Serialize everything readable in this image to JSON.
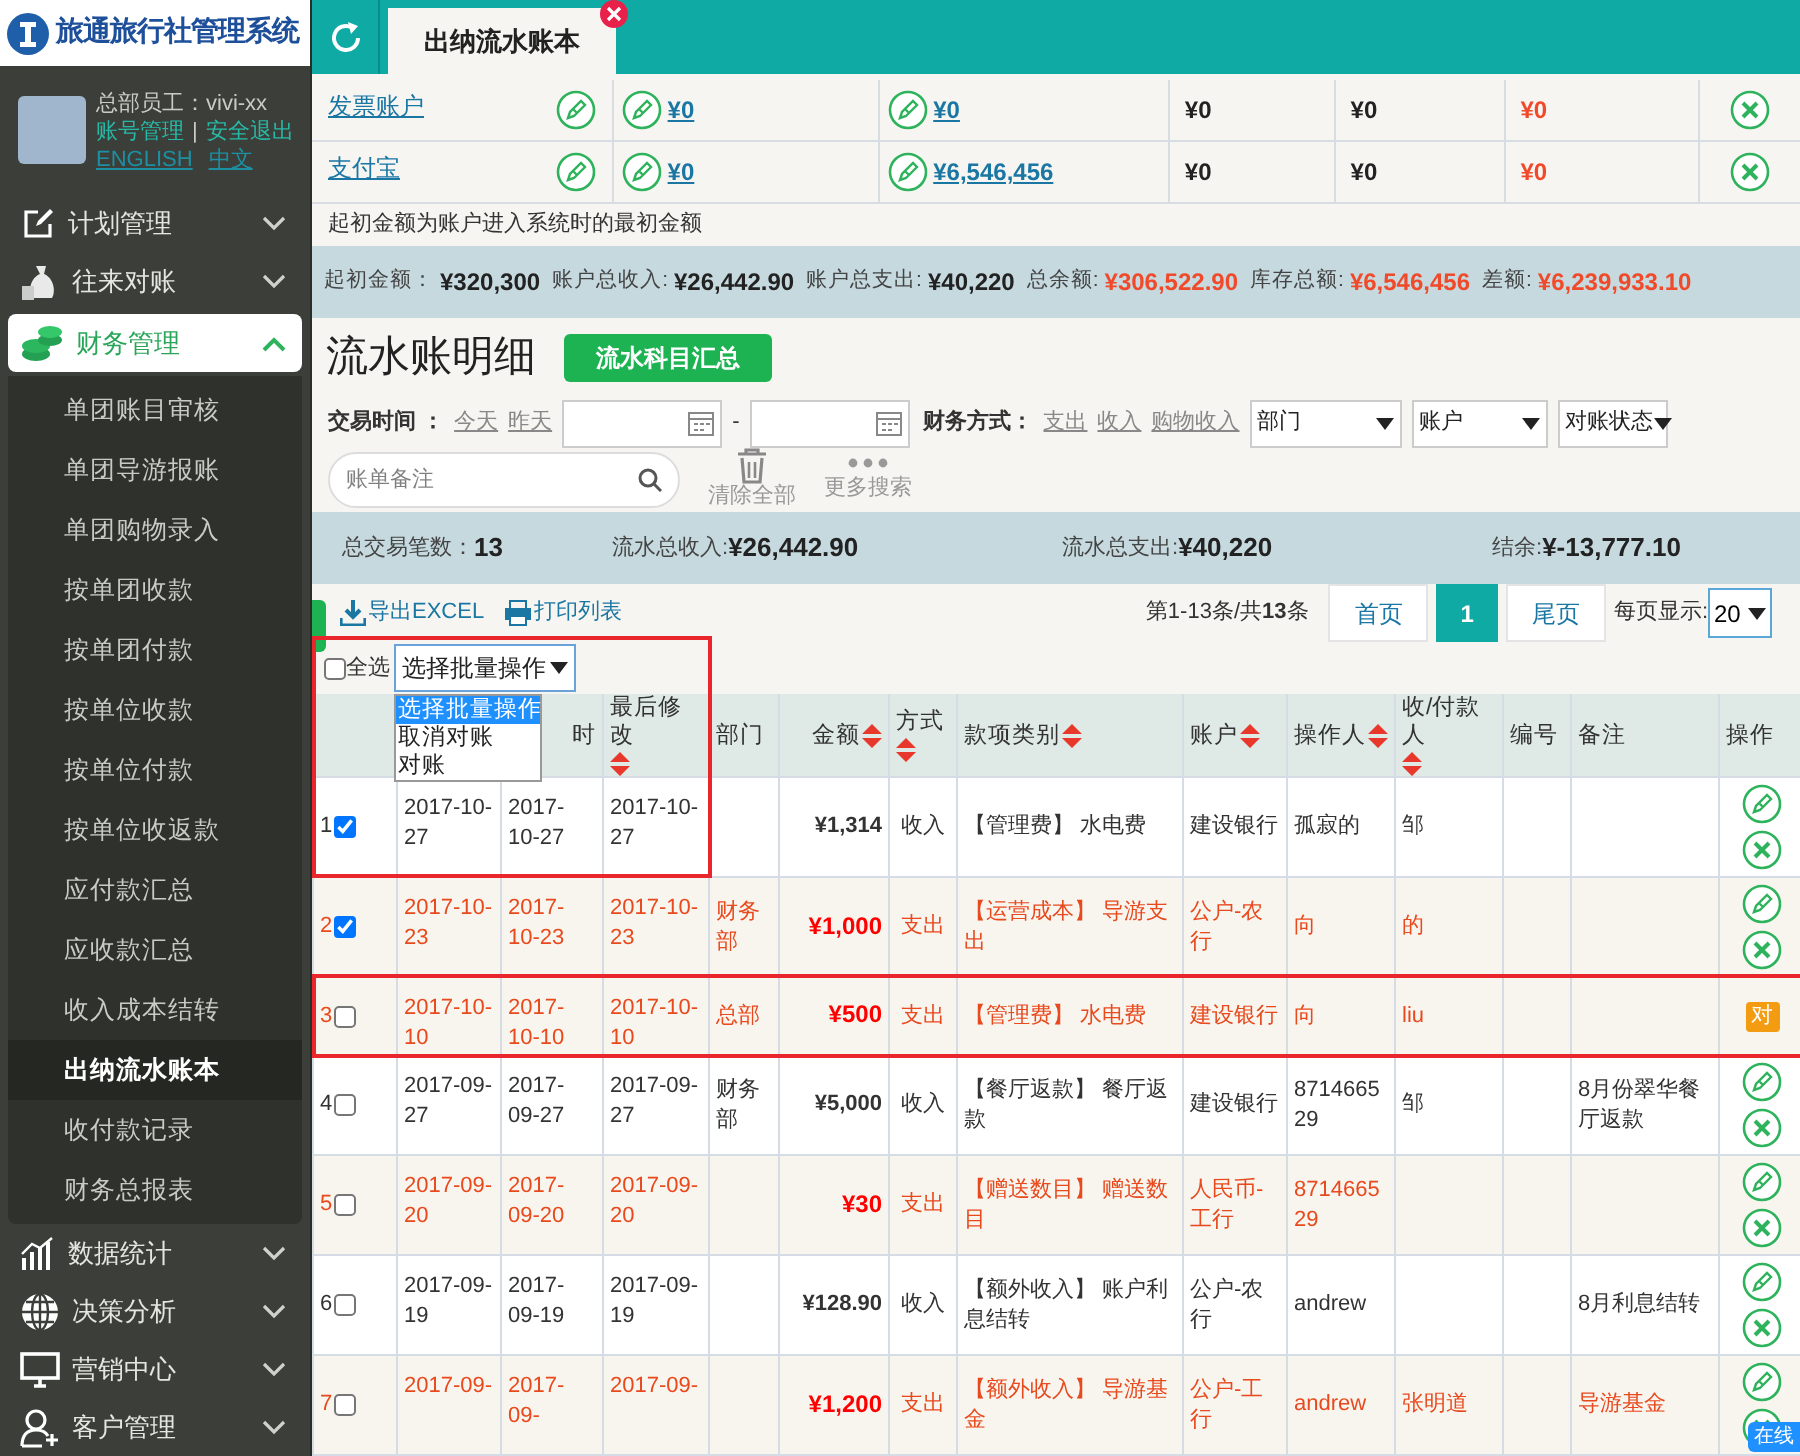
{
  "app": {
    "logo_title": "旅通旅行社管理系统"
  },
  "user": {
    "label": "总部员工：vivi-xx",
    "links": [
      "账号管理",
      "安全退出"
    ],
    "separator": "|",
    "languages": [
      "ENGLISH",
      "中文"
    ]
  },
  "sidebar": {
    "items": [
      {
        "label": "计划管理",
        "expanded": false,
        "selected": false
      },
      {
        "label": "往来对账",
        "expanded": false,
        "selected": false
      },
      {
        "label": "财务管理",
        "expanded": true,
        "selected": true,
        "children": [
          {
            "label": "单团账目审核",
            "selected": false
          },
          {
            "label": "单团导游报账",
            "selected": false
          },
          {
            "label": "单团购物录入",
            "selected": false
          },
          {
            "label": "按单团收款",
            "selected": false
          },
          {
            "label": "按单团付款",
            "selected": false
          },
          {
            "label": "按单位收款",
            "selected": false
          },
          {
            "label": "按单位付款",
            "selected": false
          },
          {
            "label": "按单位收返款",
            "selected": false
          },
          {
            "label": "应付款汇总",
            "selected": false
          },
          {
            "label": "应收款汇总",
            "selected": false
          },
          {
            "label": "收入成本结转",
            "selected": false
          },
          {
            "label": "出纳流水账本",
            "selected": true
          },
          {
            "label": "收付款记录",
            "selected": false
          },
          {
            "label": "财务总报表",
            "selected": false
          }
        ]
      },
      {
        "label": "数据统计",
        "expanded": false,
        "selected": false
      },
      {
        "label": "决策分析",
        "expanded": false,
        "selected": false
      },
      {
        "label": "营销中心",
        "expanded": false,
        "selected": false
      },
      {
        "label": "客户管理",
        "expanded": false,
        "selected": false
      }
    ]
  },
  "tabs": [
    {
      "label": "出纳流水账本",
      "selected": true
    }
  ],
  "accounts": [
    {
      "name": "发票账户",
      "values": [
        "¥0",
        "¥0",
        "¥0",
        "¥0",
        "¥0"
      ]
    },
    {
      "name": "支付宝",
      "values": [
        "¥0",
        "¥6,546,456",
        "¥0",
        "¥0",
        "¥0"
      ]
    }
  ],
  "accounts_note": "起初金额为账户进入系统时的最初金额",
  "totals": [
    {
      "label": "起初金额：",
      "value": "¥320,300",
      "highlight": false
    },
    {
      "label": "账户总收入:",
      "value": "¥26,442.90",
      "highlight": false
    },
    {
      "label": "账户总支出:",
      "value": "¥40,220",
      "highlight": false
    },
    {
      "label": "总余额:",
      "value": "¥306,522.90",
      "highlight": true
    },
    {
      "label": "库存总额:",
      "value": "¥6,546,456",
      "highlight": true
    },
    {
      "label": "差额:",
      "value": "¥6,239,933.10",
      "highlight": true
    }
  ],
  "section": {
    "title": "流水账明细",
    "button": "流水科目汇总"
  },
  "filters": {
    "time_label": "交易时间 ：",
    "time_links": [
      "今天",
      "昨天"
    ],
    "date_separator": "-",
    "method_label": "财务方式：",
    "method_links": [
      "支出",
      "收入",
      "购物收入"
    ],
    "selects": [
      "部门",
      "账户",
      "对账状态"
    ],
    "search_placeholder": "账单备注",
    "clear": "清除全部",
    "more": "更多搜索"
  },
  "stats": [
    {
      "label": "总交易笔数：",
      "value": "13"
    },
    {
      "label": "流水总收入:",
      "value": "¥26,442.90"
    },
    {
      "label": "流水总支出:",
      "value": "¥40,220"
    },
    {
      "label": "结余:",
      "value": "¥-13,777.10"
    }
  ],
  "exports": [
    "导出EXCEL",
    "打印列表"
  ],
  "pagination": {
    "summary": "第1-13条/共**13**条",
    "pages": [
      {
        "label": "首页",
        "selected": false
      },
      {
        "label": "1",
        "selected": true
      },
      {
        "label": "尾页",
        "selected": false
      }
    ],
    "per_page_label": "每页显示:",
    "per_page": "20"
  },
  "batch": {
    "select_all": "全选",
    "select_all_checked": false,
    "select": "选择批量操作",
    "options": [
      {
        "label": "选择批量操作",
        "selected": true
      },
      {
        "label": "取消对账",
        "selected": false
      },
      {
        "label": "对账",
        "selected": false
      }
    ]
  },
  "table": {
    "columns": [
      {
        "label": "时",
        "sortable": false
      },
      {
        "label": "最后修改",
        "sortable": true
      },
      {
        "label": "部门",
        "sortable": false
      },
      {
        "label": "金额",
        "sortable": true
      },
      {
        "label": "方式",
        "sortable": true
      },
      {
        "label": "款项类别",
        "sortable": true
      },
      {
        "label": "账户",
        "sortable": true
      },
      {
        "label": "操作人",
        "sortable": true
      },
      {
        "label": "收/付款人",
        "sortable": true
      },
      {
        "label": "编号",
        "sortable": false
      },
      {
        "label": "备注",
        "sortable": false
      },
      {
        "label": "操作",
        "sortable": false
      }
    ],
    "rows": [
      {
        "number": "1",
        "checked": true,
        "kind": "income",
        "outlined": true,
        "dates": [
          "2017-10-27",
          "2017-10-27",
          "2017-10-27"
        ],
        "amount": "¥1,314",
        "method": "收入",
        "category": "【管理费】 水电费",
        "account": "建设银行",
        "operator": "孤寂的",
        "payee": "邹"
      },
      {
        "number": "2",
        "checked": true,
        "kind": "expense",
        "outlined": false,
        "dates": [
          "2017-10-23",
          "2017-10-23",
          "2017-10-23"
        ],
        "department": "财务部",
        "amount": "¥1,000",
        "method": "支出",
        "category": "【运营成本】 导游支出",
        "account": "公户-农行",
        "operator": "向",
        "payee": "的"
      },
      {
        "number": "3",
        "checked": false,
        "kind": "expense",
        "outlined": true,
        "dates": [
          "2017-10-10",
          "2017-10-10",
          "2017-10-10"
        ],
        "department": "总部",
        "amount": "¥500",
        "method": "支出",
        "category": "【管理费】 水电费",
        "account": "建设银行",
        "operator": "向",
        "payee": "liu",
        "badge": "对"
      },
      {
        "number": "4",
        "checked": false,
        "kind": "income",
        "outlined": false,
        "dates": [
          "2017-09-27",
          "2017-09-27",
          "2017-09-27"
        ],
        "department": "财务部",
        "amount": "¥5,000",
        "method": "收入",
        "category": "【餐厅返款】 餐厅返款",
        "account": "建设银行",
        "operator": "871466529",
        "payee": "邹",
        "note": "8月份翠华餐厅返款"
      },
      {
        "number": "5",
        "checked": false,
        "kind": "expense",
        "outlined": false,
        "dates": [
          "2017-09-20",
          "2017-09-20",
          "2017-09-20"
        ],
        "amount": "¥30",
        "method": "支出",
        "category": "【赠送数目】 赠送数目",
        "account": "人民币-工行",
        "operator": "871466529"
      },
      {
        "number": "6",
        "checked": false,
        "kind": "income",
        "outlined": false,
        "dates": [
          "2017-09-19",
          "2017-09-19",
          "2017-09-19"
        ],
        "amount": "¥128.90",
        "method": "收入",
        "category": "【额外收入】 账户利息结转",
        "account": "公户-农行",
        "operator": "andrew",
        "note": "8月利息结转"
      },
      {
        "number": "7",
        "checked": false,
        "kind": "expense",
        "outlined": false,
        "dates": [
          "2017-09-",
          "2017-09-",
          "2017-09-"
        ],
        "amount": "¥1,200",
        "method": "支出",
        "category": "【额外收入】 导游基金",
        "account": "公户-工行",
        "operator": "andrew",
        "payee": "张明道",
        "note": "导游基金"
      }
    ]
  },
  "online_badge": "在线"
}
